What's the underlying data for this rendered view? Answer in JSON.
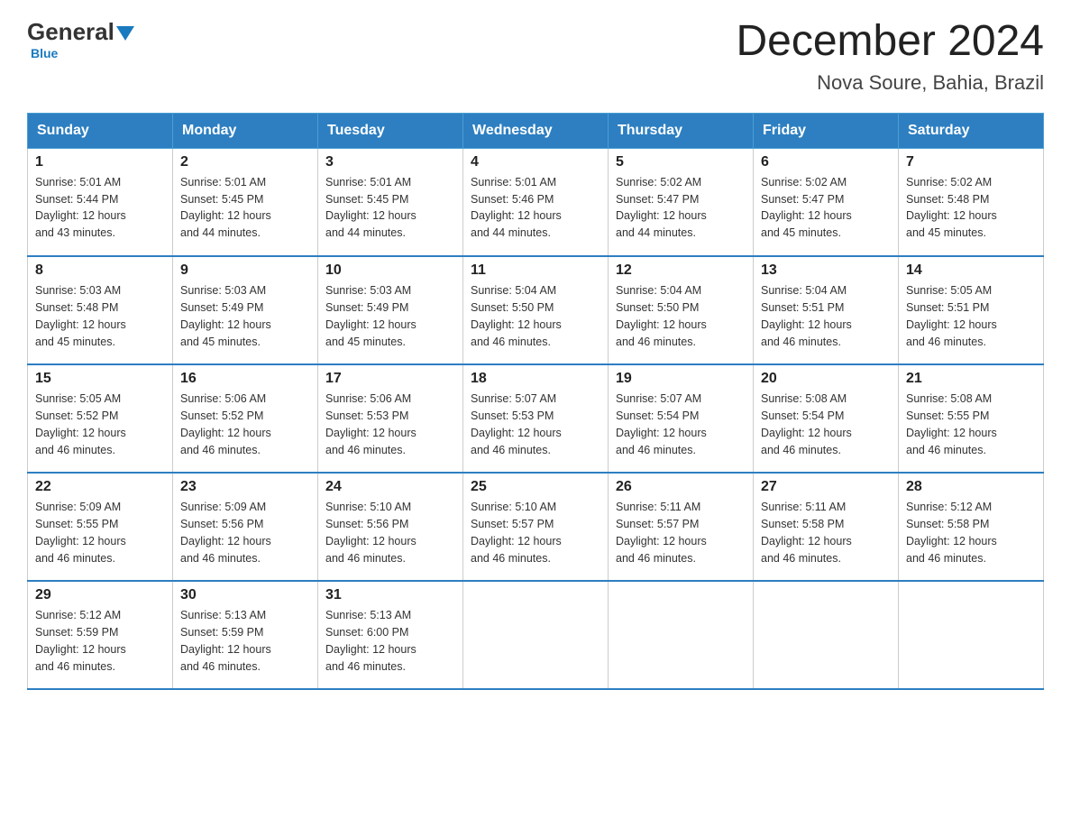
{
  "header": {
    "logo_general": "General",
    "logo_blue": "Blue",
    "month_title": "December 2024",
    "location": "Nova Soure, Bahia, Brazil"
  },
  "days_of_week": [
    "Sunday",
    "Monday",
    "Tuesday",
    "Wednesday",
    "Thursday",
    "Friday",
    "Saturday"
  ],
  "weeks": [
    [
      {
        "day": "1",
        "sunrise": "5:01 AM",
        "sunset": "5:44 PM",
        "daylight": "12 hours and 43 minutes."
      },
      {
        "day": "2",
        "sunrise": "5:01 AM",
        "sunset": "5:45 PM",
        "daylight": "12 hours and 44 minutes."
      },
      {
        "day": "3",
        "sunrise": "5:01 AM",
        "sunset": "5:45 PM",
        "daylight": "12 hours and 44 minutes."
      },
      {
        "day": "4",
        "sunrise": "5:01 AM",
        "sunset": "5:46 PM",
        "daylight": "12 hours and 44 minutes."
      },
      {
        "day": "5",
        "sunrise": "5:02 AM",
        "sunset": "5:47 PM",
        "daylight": "12 hours and 44 minutes."
      },
      {
        "day": "6",
        "sunrise": "5:02 AM",
        "sunset": "5:47 PM",
        "daylight": "12 hours and 45 minutes."
      },
      {
        "day": "7",
        "sunrise": "5:02 AM",
        "sunset": "5:48 PM",
        "daylight": "12 hours and 45 minutes."
      }
    ],
    [
      {
        "day": "8",
        "sunrise": "5:03 AM",
        "sunset": "5:48 PM",
        "daylight": "12 hours and 45 minutes."
      },
      {
        "day": "9",
        "sunrise": "5:03 AM",
        "sunset": "5:49 PM",
        "daylight": "12 hours and 45 minutes."
      },
      {
        "day": "10",
        "sunrise": "5:03 AM",
        "sunset": "5:49 PM",
        "daylight": "12 hours and 45 minutes."
      },
      {
        "day": "11",
        "sunrise": "5:04 AM",
        "sunset": "5:50 PM",
        "daylight": "12 hours and 46 minutes."
      },
      {
        "day": "12",
        "sunrise": "5:04 AM",
        "sunset": "5:50 PM",
        "daylight": "12 hours and 46 minutes."
      },
      {
        "day": "13",
        "sunrise": "5:04 AM",
        "sunset": "5:51 PM",
        "daylight": "12 hours and 46 minutes."
      },
      {
        "day": "14",
        "sunrise": "5:05 AM",
        "sunset": "5:51 PM",
        "daylight": "12 hours and 46 minutes."
      }
    ],
    [
      {
        "day": "15",
        "sunrise": "5:05 AM",
        "sunset": "5:52 PM",
        "daylight": "12 hours and 46 minutes."
      },
      {
        "day": "16",
        "sunrise": "5:06 AM",
        "sunset": "5:52 PM",
        "daylight": "12 hours and 46 minutes."
      },
      {
        "day": "17",
        "sunrise": "5:06 AM",
        "sunset": "5:53 PM",
        "daylight": "12 hours and 46 minutes."
      },
      {
        "day": "18",
        "sunrise": "5:07 AM",
        "sunset": "5:53 PM",
        "daylight": "12 hours and 46 minutes."
      },
      {
        "day": "19",
        "sunrise": "5:07 AM",
        "sunset": "5:54 PM",
        "daylight": "12 hours and 46 minutes."
      },
      {
        "day": "20",
        "sunrise": "5:08 AM",
        "sunset": "5:54 PM",
        "daylight": "12 hours and 46 minutes."
      },
      {
        "day": "21",
        "sunrise": "5:08 AM",
        "sunset": "5:55 PM",
        "daylight": "12 hours and 46 minutes."
      }
    ],
    [
      {
        "day": "22",
        "sunrise": "5:09 AM",
        "sunset": "5:55 PM",
        "daylight": "12 hours and 46 minutes."
      },
      {
        "day": "23",
        "sunrise": "5:09 AM",
        "sunset": "5:56 PM",
        "daylight": "12 hours and 46 minutes."
      },
      {
        "day": "24",
        "sunrise": "5:10 AM",
        "sunset": "5:56 PM",
        "daylight": "12 hours and 46 minutes."
      },
      {
        "day": "25",
        "sunrise": "5:10 AM",
        "sunset": "5:57 PM",
        "daylight": "12 hours and 46 minutes."
      },
      {
        "day": "26",
        "sunrise": "5:11 AM",
        "sunset": "5:57 PM",
        "daylight": "12 hours and 46 minutes."
      },
      {
        "day": "27",
        "sunrise": "5:11 AM",
        "sunset": "5:58 PM",
        "daylight": "12 hours and 46 minutes."
      },
      {
        "day": "28",
        "sunrise": "5:12 AM",
        "sunset": "5:58 PM",
        "daylight": "12 hours and 46 minutes."
      }
    ],
    [
      {
        "day": "29",
        "sunrise": "5:12 AM",
        "sunset": "5:59 PM",
        "daylight": "12 hours and 46 minutes."
      },
      {
        "day": "30",
        "sunrise": "5:13 AM",
        "sunset": "5:59 PM",
        "daylight": "12 hours and 46 minutes."
      },
      {
        "day": "31",
        "sunrise": "5:13 AM",
        "sunset": "6:00 PM",
        "daylight": "12 hours and 46 minutes."
      },
      null,
      null,
      null,
      null
    ]
  ],
  "labels": {
    "sunrise": "Sunrise:",
    "sunset": "Sunset:",
    "daylight": "Daylight:"
  }
}
